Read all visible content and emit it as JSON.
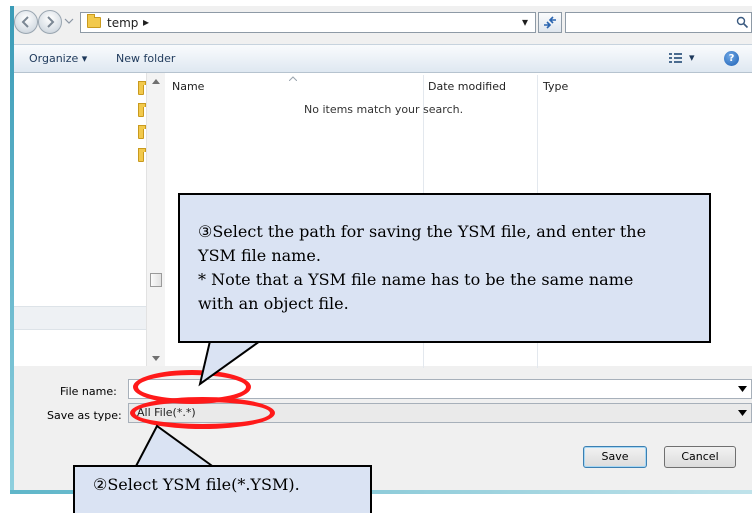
{
  "address_bar": {
    "path_segments": [
      "temp"
    ],
    "path_arrow": "▸",
    "dropdown_arrow": "▾",
    "search_placeholder": ""
  },
  "toolbar": {
    "organize_label": "Organize ▾",
    "new_folder_label": "New folder",
    "view_menu_arrow": "▾",
    "help_glyph": "?"
  },
  "file_list": {
    "columns": [
      "Name",
      "Date modified",
      "Type"
    ],
    "empty_message": "No items match your search."
  },
  "form": {
    "file_name_label": "File name:",
    "file_name_value": "",
    "save_as_type_label": "Save as type:",
    "save_as_type_value": "All File(*.*)",
    "save_label": "Save",
    "cancel_label": "Cancel"
  },
  "callout_path": {
    "line1": "③Select the path for saving the YSM file, and enter the",
    "line2": "YSM file name.",
    "line3": "* Note that a YSM file name has to be the same name",
    "line4": "with an object file."
  },
  "callout_type": {
    "text": "②Select YSM file(*.YSM)."
  },
  "colors": {
    "callout_fill": "#dae3f3",
    "highlight": "#ff1a1a",
    "folder": "#f2c94c"
  }
}
